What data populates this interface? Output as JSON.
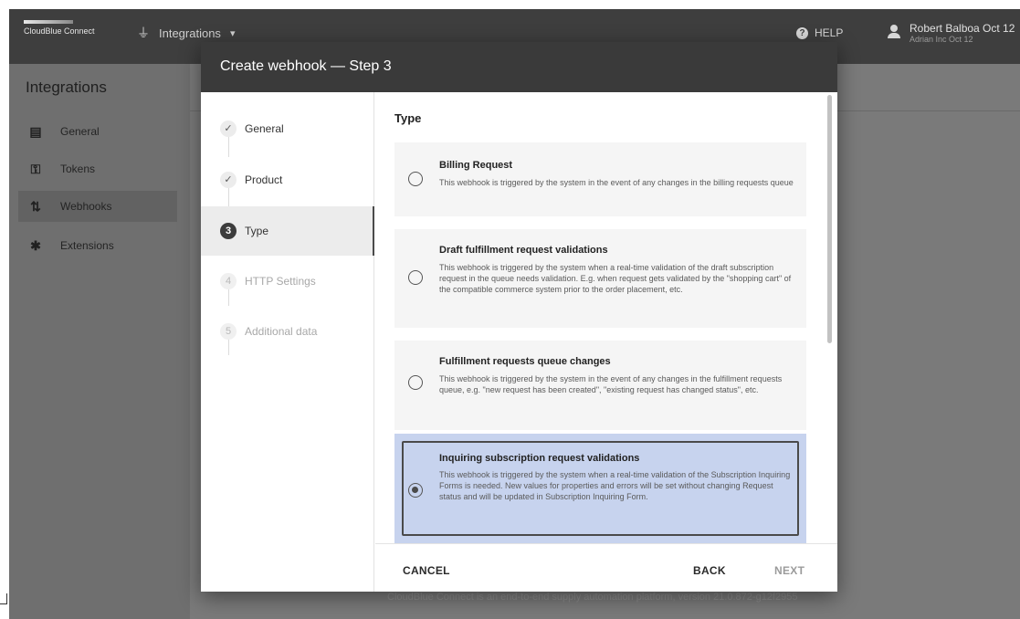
{
  "app": {
    "brand": "CloudBlue Connect",
    "module": "Integrations",
    "help_label": "HELP",
    "user_name": "Robert Balboa Oct 12",
    "user_sub": "Adrian Inc Oct 12"
  },
  "sidebar": {
    "title": "Integrations",
    "items": [
      {
        "label": "General",
        "icon": "clipboard-icon"
      },
      {
        "label": "Tokens",
        "icon": "key-icon"
      },
      {
        "label": "Webhooks",
        "icon": "sync-icon",
        "active": true
      },
      {
        "label": "Extensions",
        "icon": "puzzle-icon"
      }
    ]
  },
  "footer": {
    "text": "CloudBlue Connect is an end-to-end supply automation platform, version 21.0.872-g12f2955"
  },
  "dialog": {
    "title": "Create webhook — Step 3",
    "steps": [
      {
        "marker": "✓",
        "label": "General",
        "state": "done"
      },
      {
        "marker": "✓",
        "label": "Product",
        "state": "done"
      },
      {
        "marker": "3",
        "label": "Type",
        "state": "active"
      },
      {
        "marker": "4",
        "label": "HTTP Settings",
        "state": "disabled"
      },
      {
        "marker": "5",
        "label": "Additional data",
        "state": "disabled"
      }
    ],
    "section_title": "Type",
    "options": [
      {
        "title": "Billing Request",
        "description": "This webhook is triggered by the system in the event of any changes in the billing requests queue",
        "selected": false
      },
      {
        "title": "Draft fulfillment request validations",
        "description": "This webhook is triggered by the system when a real-time validation of the draft subscription request in the queue needs validation. E.g. when request gets validated by the \"shopping cart\" of the compatible commerce system prior to the order placement, etc.",
        "selected": false
      },
      {
        "title": "Fulfillment requests queue changes",
        "description": "This webhook is triggered by the system in the event of any changes in the fulfillment requests queue, e.g. \"new request has been created\", \"existing request has changed status\", etc.",
        "selected": false
      },
      {
        "title": "Inquiring subscription request validations",
        "description": "This webhook is triggered by the system when a real-time validation of the Subscription Inquiring Forms is needed. New values for properties and errors will be set without changing Request status and will be updated in Subscription Inquiring Form.",
        "selected": true
      }
    ],
    "buttons": {
      "cancel": "CANCEL",
      "back": "BACK",
      "next": "NEXT"
    }
  },
  "colors": {
    "header": "#3a3a3a",
    "selected_option": "#c7d3ee",
    "overlay": "#7a7a7a"
  }
}
